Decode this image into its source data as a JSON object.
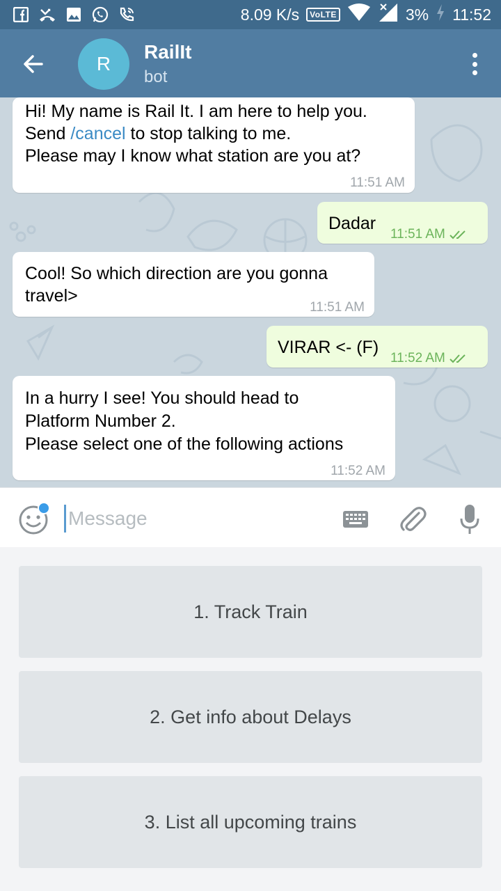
{
  "status_bar": {
    "net_speed": "8.09 K/s",
    "volte_label": "VoLTE",
    "battery": "3%",
    "clock": "11:52",
    "left_icons": [
      "facebook-icon",
      "missed-call-icon",
      "gallery-icon",
      "whatsapp-icon",
      "call-icon"
    ]
  },
  "header": {
    "avatar_letter": "R",
    "title": "RailIt",
    "subtitle": "bot"
  },
  "messages": [
    {
      "dir": "in",
      "lines": [
        "Hi! My name is Rail It. I am here to help you.",
        "Please may I know what station are you at?"
      ],
      "cmd_line": {
        "before": "Send ",
        "cmd": "/cancel",
        "after": " to stop talking to me."
      },
      "time": "11:51 AM"
    },
    {
      "dir": "out",
      "text": "Dadar",
      "time": "11:51 AM"
    },
    {
      "dir": "in",
      "lines": [
        "Cool! So which direction are you gonna",
        "travel>"
      ],
      "time": "11:51 AM"
    },
    {
      "dir": "out",
      "text": "VIRAR <- (F)",
      "time": "11:52 AM"
    },
    {
      "dir": "in",
      "lines": [
        "In a hurry I see! You should head to",
        "Platform Number 2.",
        "Please select one of the following actions"
      ],
      "time": "11:52 AM"
    }
  ],
  "composer": {
    "placeholder": "Message"
  },
  "bot_keyboard": [
    {
      "label": "1. Track Train"
    },
    {
      "label": "2. Get info about Delays"
    },
    {
      "label": "3. List all upcoming trains"
    }
  ],
  "colors": {
    "status_bar": "#3f6a8c",
    "header": "#517da2",
    "chat_bg": "#cad6de",
    "incoming_bubble": "#ffffff",
    "outgoing_bubble": "#effdde",
    "outgoing_time": "#6cb45b",
    "command_link": "#3a8ac4",
    "keyboard_button": "#e1e5e8"
  }
}
